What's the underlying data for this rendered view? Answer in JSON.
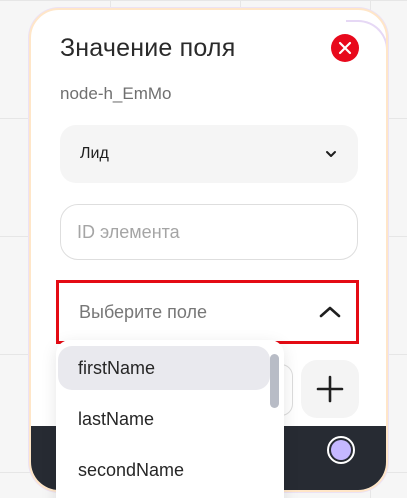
{
  "node": {
    "title": "Значение поля",
    "id_text": "node-h_EmMo",
    "entity_select": {
      "value": "Лид"
    },
    "element_id_input": {
      "value": "",
      "placeholder": "ID элемента"
    },
    "field_select": {
      "placeholder": "Выберите поле"
    },
    "dropdown": {
      "options": [
        "firstName",
        "lastName",
        "secondName"
      ],
      "highlighted": "firstName"
    }
  },
  "icons": {
    "close": "close-icon",
    "entity_chevron": "chevron-down-icon",
    "field_chevron": "chevron-up-icon",
    "add": "plus-icon",
    "footer_indicator": "radio-indicator-icon"
  },
  "colors": {
    "close_button": "#e8091c",
    "highlight_border": "#e40b14",
    "footer": "#272b33",
    "indicator": "#c5b8ff"
  }
}
